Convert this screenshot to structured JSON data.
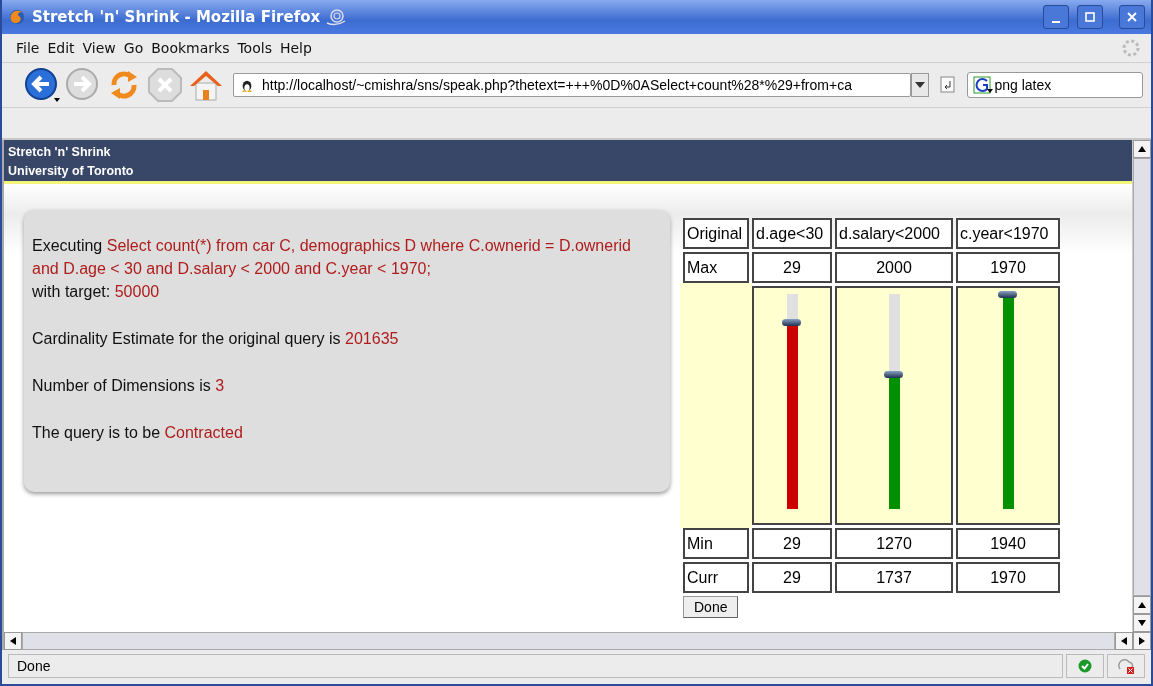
{
  "window": {
    "title": "Stretch 'n' Shrink - Mozilla Firefox"
  },
  "menu": [
    "File",
    "Edit",
    "View",
    "Go",
    "Bookmarks",
    "Tools",
    "Help"
  ],
  "address": {
    "value": "http://localhost/~cmishra/sns/speak.php?thetext=+++%0D%0ASelect+count%28*%29+from+ca"
  },
  "search": {
    "value": "png latex"
  },
  "header": {
    "title": "Stretch 'n' Shrink",
    "subtitle": "University of Toronto"
  },
  "info": [
    {
      "label": "Executing",
      "value": "Select count(*) from car C, demographics D where C.ownerid = D.ownerid and D.age < 30 and D.salary < 2000 and C.year < 1970;"
    },
    {
      "label": "with target:",
      "value": "50000"
    },
    {
      "label": "Cardinality Estimate for the original query is",
      "value": "201635"
    },
    {
      "label": "Number of Dimensions is",
      "value": "3"
    },
    {
      "label": "The query is to be",
      "value": "Contracted"
    }
  ],
  "table": {
    "corner": "Original",
    "row_labels": {
      "max": "Max",
      "min": "Min",
      "curr": "Curr"
    },
    "columns": [
      {
        "header": "d.age<30",
        "max": "29",
        "min": "29",
        "curr": "29",
        "level": 0.87,
        "color": "#cc0000"
      },
      {
        "header": "d.salary<2000",
        "max": "2000",
        "min": "1270",
        "curr": "1737",
        "level": 0.63,
        "color": "#009000"
      },
      {
        "header": "c.year<1970",
        "max": "1970",
        "min": "1940",
        "curr": "1970",
        "level": 1.0,
        "color": "#009000"
      }
    ]
  },
  "done_button": "Done",
  "status_bar": {
    "text": "Done"
  }
}
